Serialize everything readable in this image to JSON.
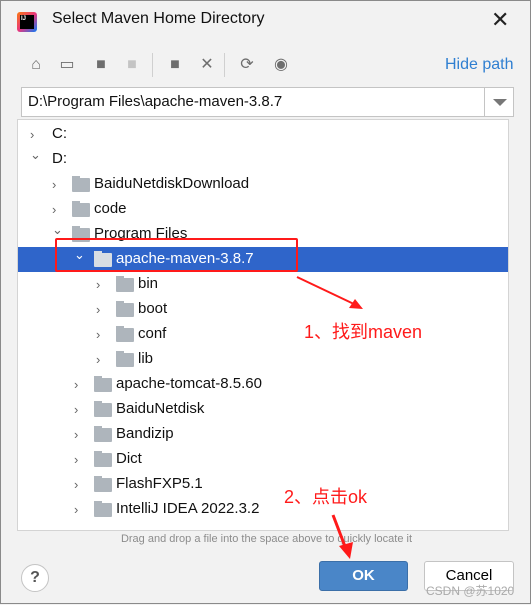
{
  "window": {
    "title": "Select Maven Home Directory"
  },
  "toolbar": {
    "icons": [
      "home-icon",
      "desktop-icon",
      "project-folder-icon",
      "module-folder-icon",
      "new-folder-icon",
      "delete-icon",
      "refresh-icon",
      "show-hidden-icon"
    ],
    "hide_path": "Hide path"
  },
  "path": {
    "value": "D:\\Program Files\\apache-maven-3.8.7"
  },
  "tree": [
    {
      "label": "C:",
      "depth": 0,
      "expanded": false
    },
    {
      "label": "D:",
      "depth": 0,
      "expanded": true
    },
    {
      "label": "BaiduNetdiskDownload",
      "depth": 1,
      "expanded": false
    },
    {
      "label": "code",
      "depth": 1,
      "expanded": false
    },
    {
      "label": "Program Files",
      "depth": 1,
      "expanded": true
    },
    {
      "label": "apache-maven-3.8.7",
      "depth": 2,
      "expanded": true,
      "selected": true
    },
    {
      "label": "bin",
      "depth": 3,
      "expanded": false
    },
    {
      "label": "boot",
      "depth": 3,
      "expanded": false
    },
    {
      "label": "conf",
      "depth": 3,
      "expanded": false
    },
    {
      "label": "lib",
      "depth": 3,
      "expanded": false
    },
    {
      "label": "apache-tomcat-8.5.60",
      "depth": 2,
      "expanded": false
    },
    {
      "label": "BaiduNetdisk",
      "depth": 2,
      "expanded": false
    },
    {
      "label": "Bandizip",
      "depth": 2,
      "expanded": false
    },
    {
      "label": "Dict",
      "depth": 2,
      "expanded": false
    },
    {
      "label": "FlashFXP5.1",
      "depth": 2,
      "expanded": false
    },
    {
      "label": "IntelliJ IDEA 2022.3.2",
      "depth": 2,
      "expanded": false
    }
  ],
  "hint": "Drag and drop a file into the space above to quickly locate it",
  "buttons": {
    "help": "?",
    "ok": "OK",
    "cancel": "Cancel"
  },
  "annotations": {
    "step1": "1、找到maven",
    "step2": "2、点击ok",
    "color": "#ff1a1a"
  },
  "watermark": "CSDN @苏1020"
}
